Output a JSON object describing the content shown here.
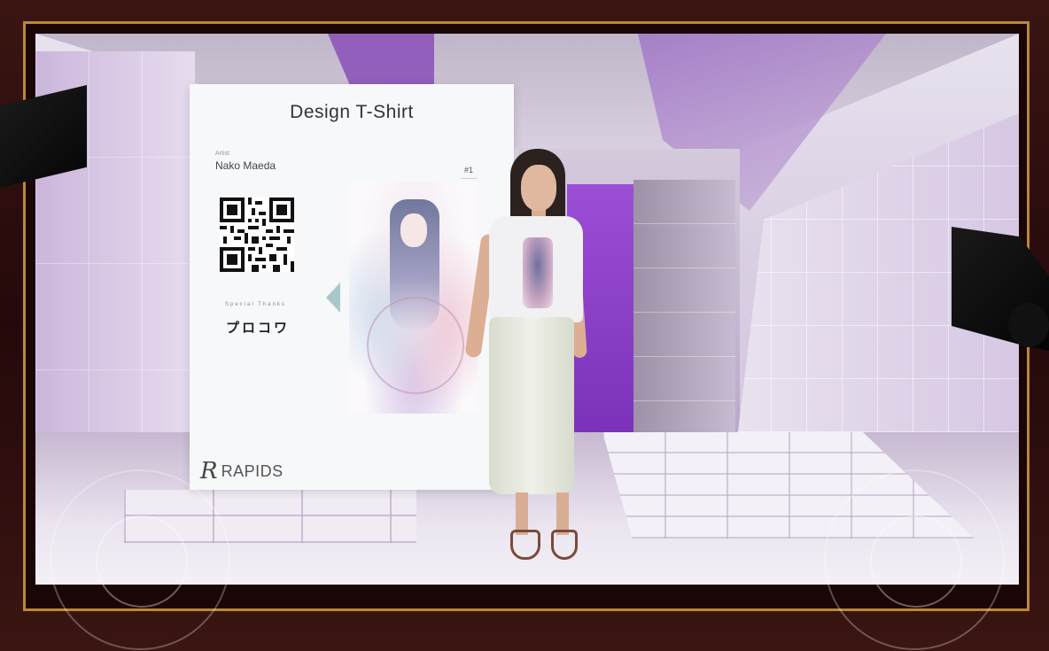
{
  "panel": {
    "title": "Design T-Shirt",
    "artist_label": "Artist",
    "artist_name": "Nako Maeda",
    "item_number": "#1",
    "special_thanks_label": "Special Thanks",
    "special_thanks_brand": "プロコワ",
    "logo_text": "RAPIDS"
  },
  "colors": {
    "accent_purple": "#8a4fb8",
    "frame_gold": "#b8883a",
    "arrow_teal": "#a9c7cb"
  },
  "icons": {
    "prev": "chevron-left-icon",
    "qr": "qr-code-icon",
    "logo": "rapids-logo-icon"
  }
}
